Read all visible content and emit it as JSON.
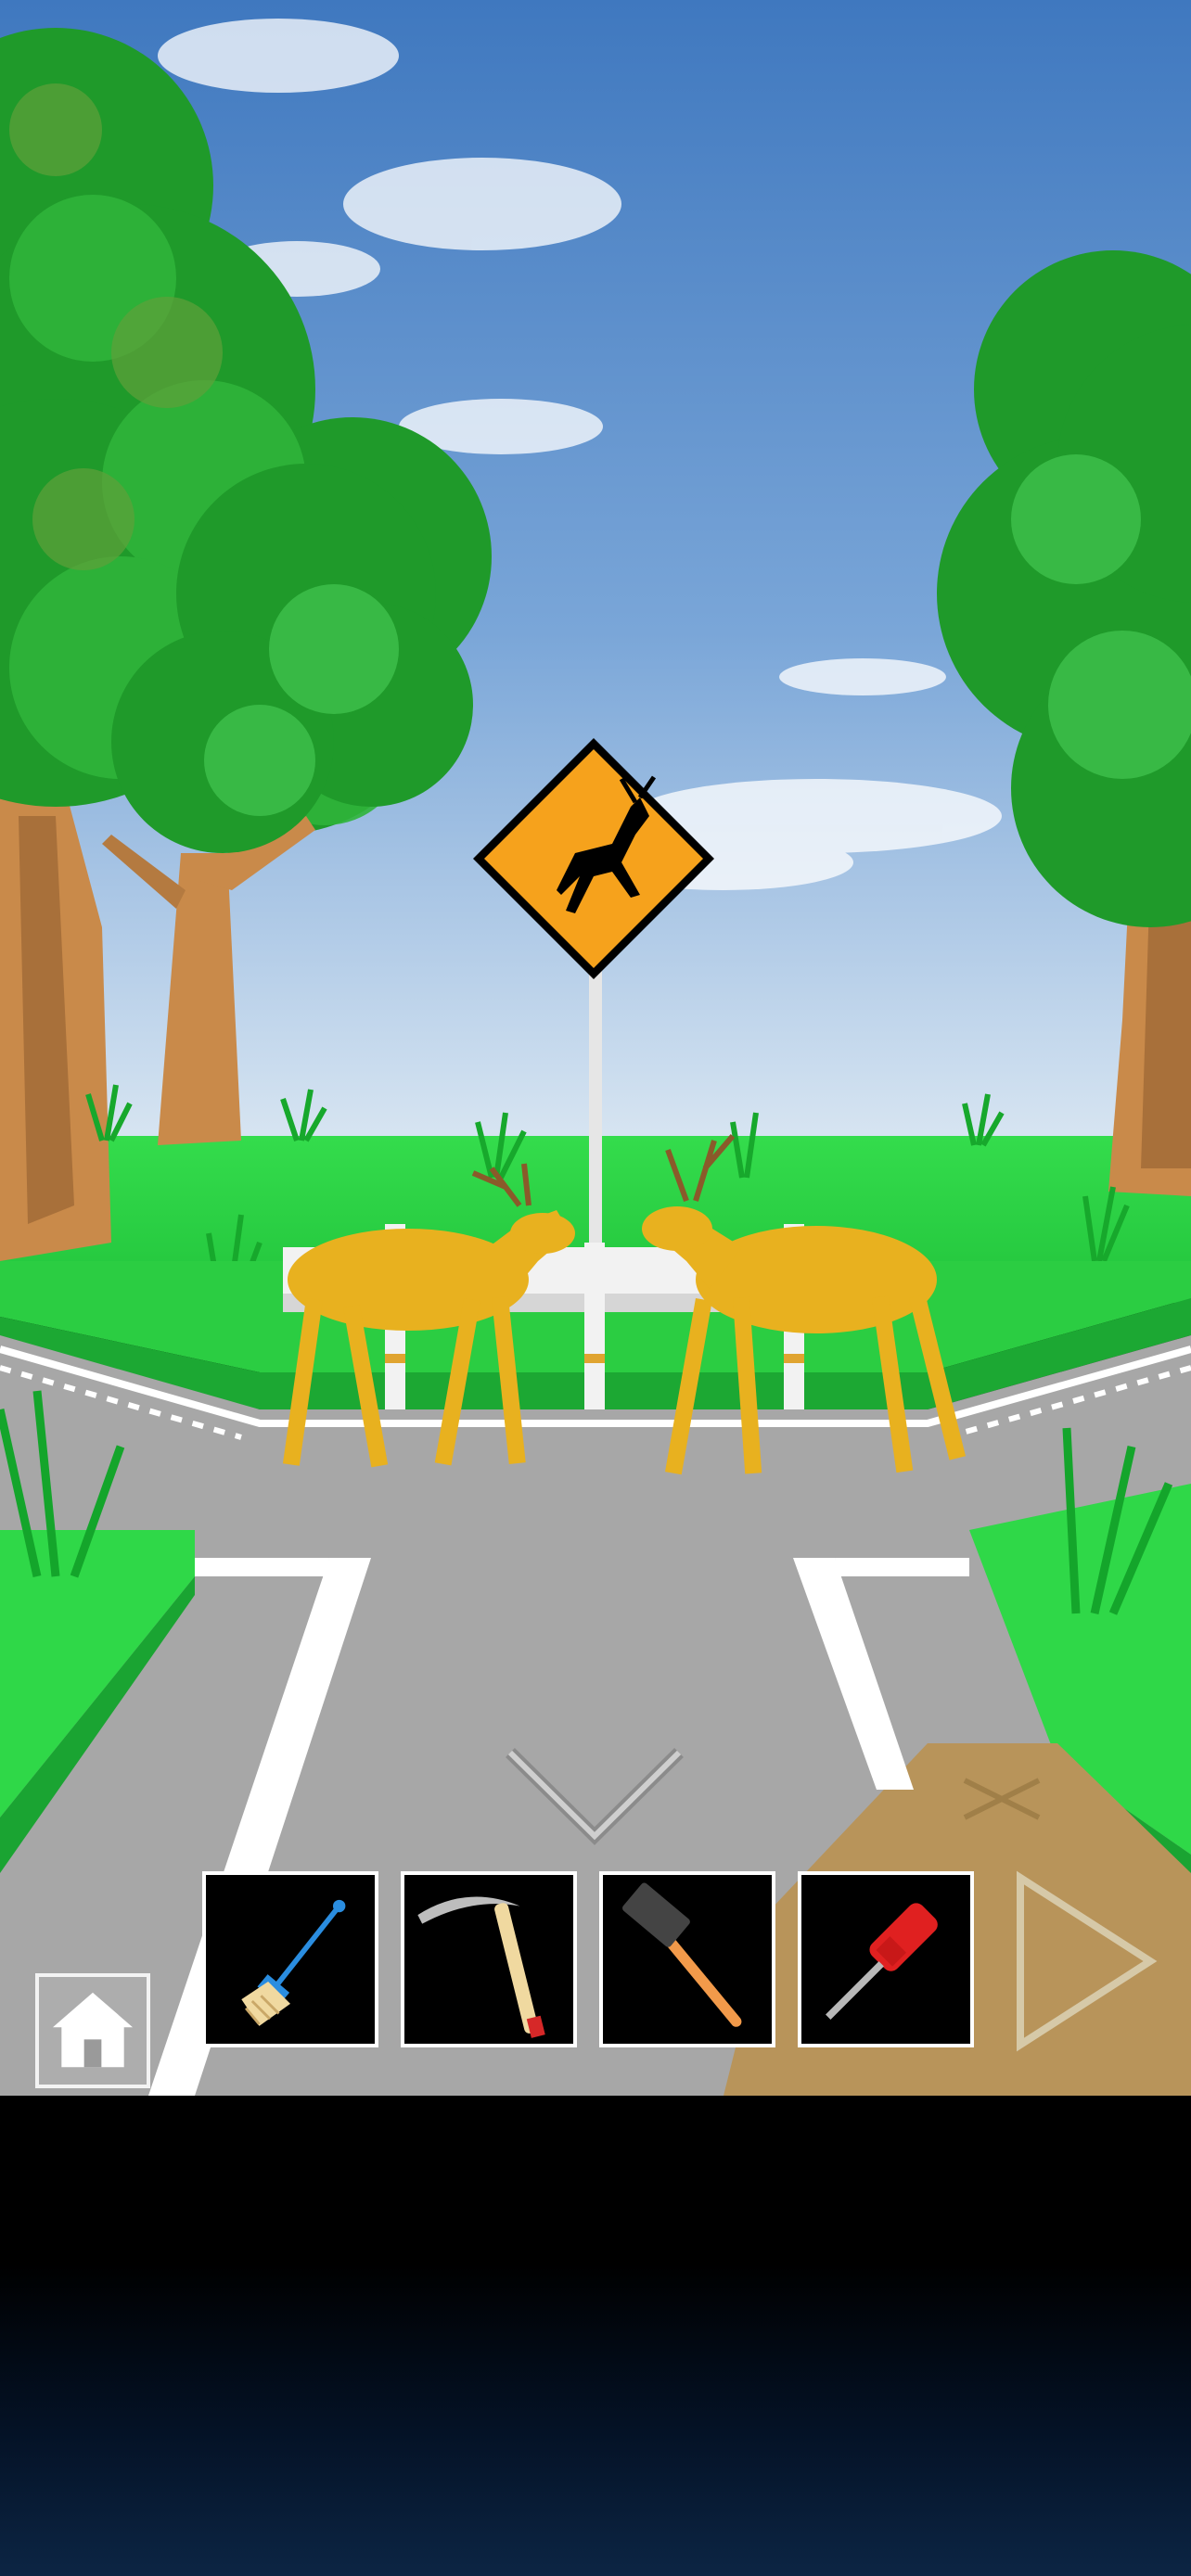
{
  "scene": {
    "name": "intersection-with-deer",
    "sky_color": "#4f86c6",
    "grass_color": "#2fd848",
    "road_color": "#a9a9a9",
    "sign_color": "#f6a21c"
  },
  "navigation": {
    "down_arrow_icon": "chevron-down-icon",
    "right_arrow_icon": "triangle-right-icon",
    "home_icon": "home-icon"
  },
  "inventory": {
    "items": [
      {
        "name": "brush",
        "icon": "brush-icon"
      },
      {
        "name": "sickle",
        "icon": "sickle-icon"
      },
      {
        "name": "hammer",
        "icon": "hammer-icon"
      },
      {
        "name": "screwdriver",
        "icon": "screwdriver-icon"
      }
    ]
  },
  "colors": {
    "slot_border": "#ffffff",
    "slot_background": "#000000",
    "deer": "#e8b11f"
  }
}
